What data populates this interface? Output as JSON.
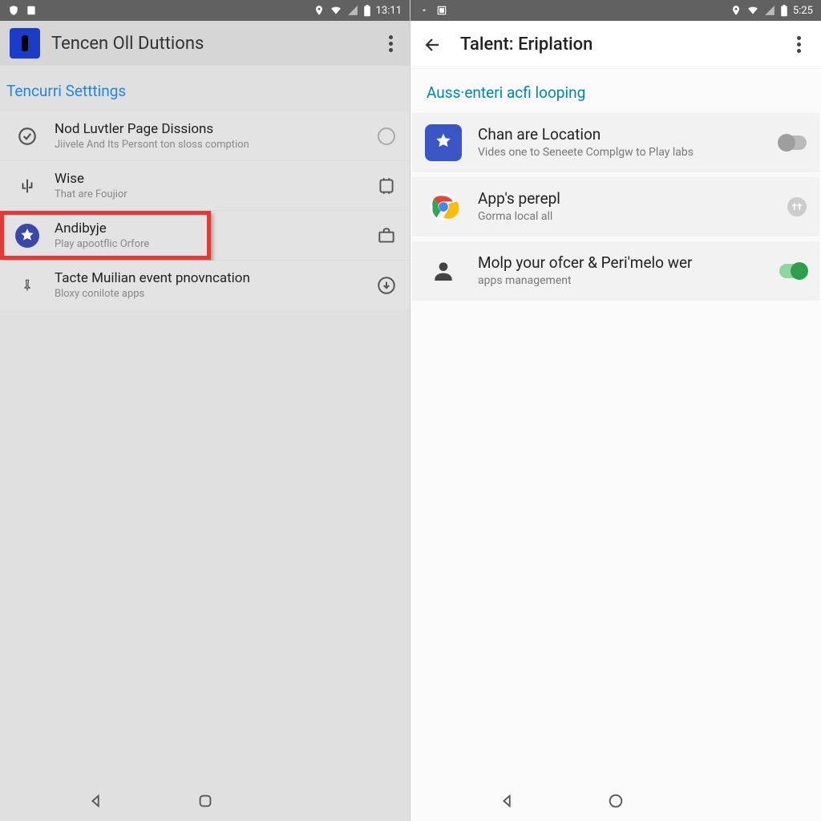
{
  "left": {
    "statusbar": {
      "time": "13:11"
    },
    "header": {
      "title": "Tencen Oll Duttions"
    },
    "section": "Tencurri Setttings",
    "items": [
      {
        "title": "Nod Luvtler Page Dissions",
        "sub": "Jiivele And Its Persont ton sloss comption"
      },
      {
        "title": "Wise",
        "sub": "That are Foujior"
      },
      {
        "title": "Andibyje",
        "sub": "Play apootflic Orfore"
      },
      {
        "title": "Tacte Muilian event pnovncation",
        "sub": "Bloxy conilote apps"
      }
    ]
  },
  "right": {
    "statusbar": {
      "time": "5:25"
    },
    "header": {
      "title": "Talent: Eriplation"
    },
    "section": "Auss·enteri acfi looping",
    "cards": [
      {
        "title": "Chan are Location",
        "sub": "Vides one to Seneete Complgw to Play labs"
      },
      {
        "title": "App's perepl",
        "sub": "Gorma local all"
      },
      {
        "title": "Molp your ofcer & Peri'melo wer",
        "sub": "apps management"
      }
    ]
  }
}
